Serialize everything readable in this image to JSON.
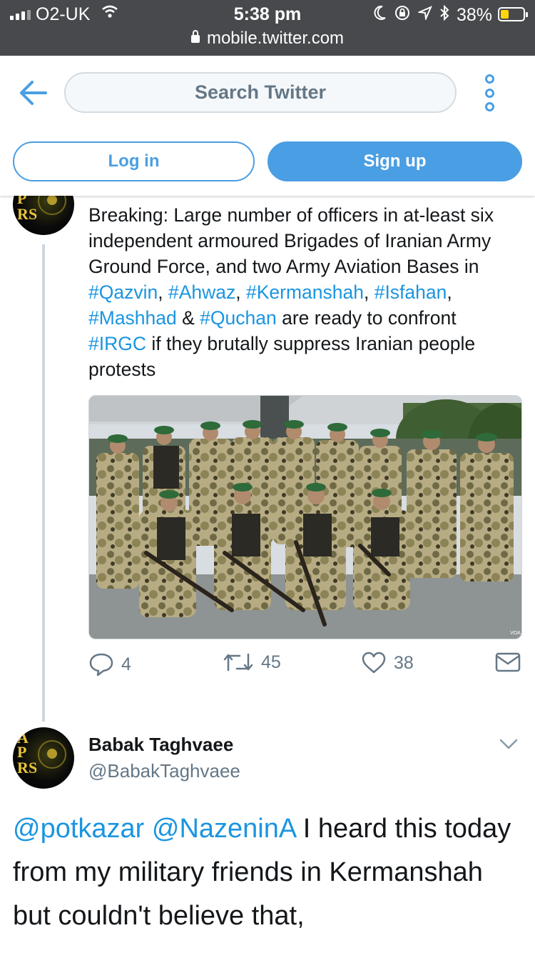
{
  "status_bar": {
    "carrier": "O2-UK",
    "time": "5:38 pm",
    "battery_pct": "38%",
    "battery_level": 0.38,
    "url": "mobile.twitter.com",
    "icons": [
      "signal-icon",
      "wifi-icon",
      "moon-icon",
      "rotation-lock-icon",
      "location-icon",
      "bluetooth-icon",
      "battery-icon",
      "lock-icon"
    ]
  },
  "header": {
    "search_placeholder": "Search Twitter",
    "login_label": "Log in",
    "signup_label": "Sign up",
    "accent_color": "#4a9ee3"
  },
  "tweet1": {
    "text_parts": [
      {
        "t": "Breaking: Large number of officers in at-least six independent armoured Brigades of Iranian Army Ground Force, and two Army Aviation Bases in ",
        "tag": false
      },
      {
        "t": "#Qazvin",
        "tag": true
      },
      {
        "t": ", ",
        "tag": false
      },
      {
        "t": "#Ahwaz",
        "tag": true
      },
      {
        "t": ", ",
        "tag": false
      },
      {
        "t": "#Kermanshah",
        "tag": true
      },
      {
        "t": ", ",
        "tag": false
      },
      {
        "t": "#Isfahan",
        "tag": true
      },
      {
        "t": ", ",
        "tag": false
      },
      {
        "t": "#Mashhad",
        "tag": true
      },
      {
        "t": " & ",
        "tag": false
      },
      {
        "t": "#Quchan",
        "tag": true
      },
      {
        "t": " are ready to confront ",
        "tag": false
      },
      {
        "t": "#IRGC",
        "tag": true
      },
      {
        "t": " if they brutally suppress Iranian people protests",
        "tag": false
      }
    ],
    "replies": "4",
    "retweets": "45",
    "likes": "38",
    "media_watermark": "VOA",
    "link_color": "#1b95e0"
  },
  "tweet2": {
    "author_name": "Babak Taghvaee",
    "author_handle": "@BabakTaghvaee",
    "text_parts": [
      {
        "t": "@potkazar",
        "tag": true
      },
      {
        "t": " ",
        "tag": false
      },
      {
        "t": "@NazeninA",
        "tag": true
      },
      {
        "t": " I heard this today from my military friends in Kermanshah but couldn't believe that,",
        "tag": false
      }
    ]
  },
  "avatar_letters": [
    "A",
    "P",
    "R",
    "S"
  ]
}
